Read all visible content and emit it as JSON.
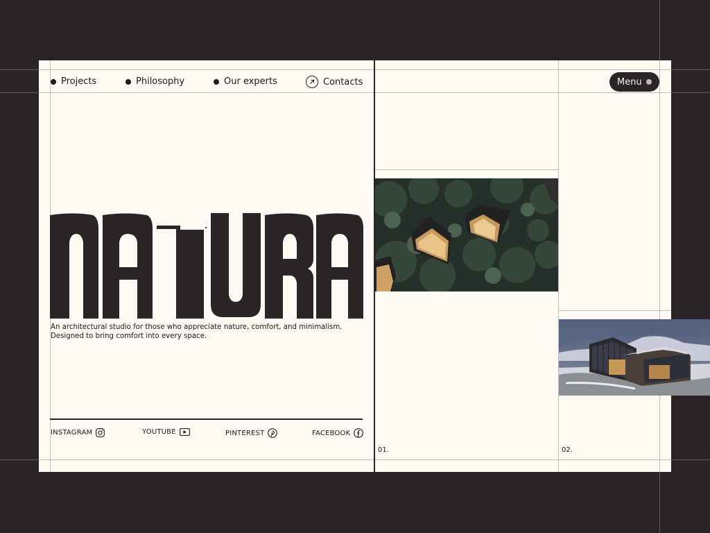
{
  "nav": {
    "items": [
      {
        "label": "Projects"
      },
      {
        "label": "Philosophy"
      },
      {
        "label": "Our experts"
      }
    ],
    "contacts_label": "Contacts",
    "menu_label": "Menu"
  },
  "hero": {
    "title": "NATURA",
    "tagline_line1": "An architectural studio for those who appreciate nature, comfort, and  minimalism.",
    "tagline_line2": "Designed to bring comfort into every space."
  },
  "social": [
    {
      "label": "INSTAGRAM",
      "icon": "instagram-icon"
    },
    {
      "label": "YOUTUBE",
      "icon": "youtube-icon"
    },
    {
      "label": "PINTEREST",
      "icon": "pinterest-icon"
    },
    {
      "label": "FACEBOOK",
      "icon": "facebook-icon"
    }
  ],
  "gallery": {
    "numbers": [
      "01.",
      "02."
    ]
  },
  "colors": {
    "background": "#292526",
    "page": "#fcfaf3",
    "ink": "#1d1a1b"
  }
}
